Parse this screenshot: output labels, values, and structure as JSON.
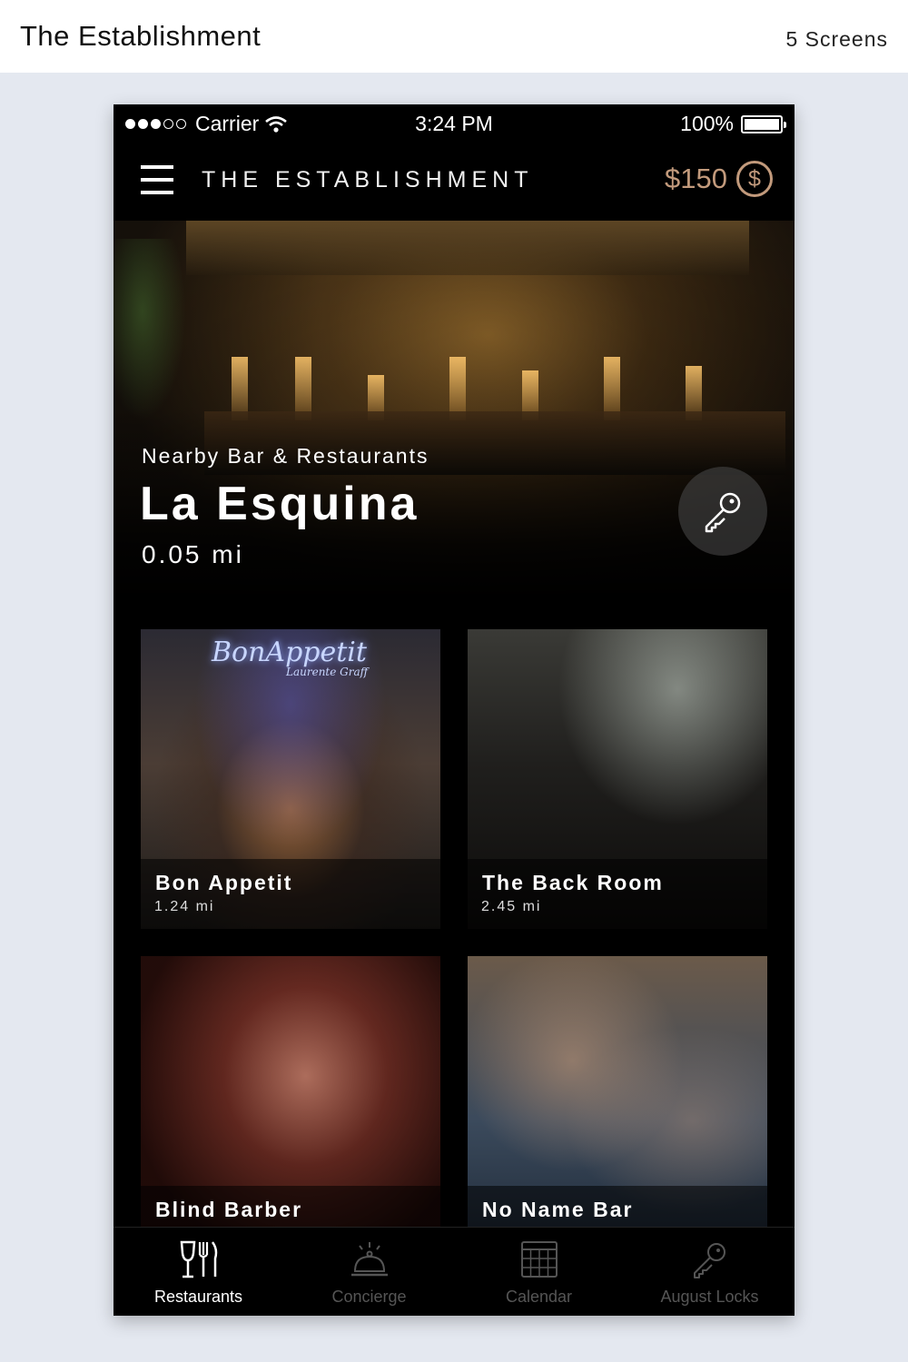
{
  "page": {
    "title": "The Establishment",
    "screens": "5 Screens"
  },
  "status": {
    "carrier": "Carrier",
    "time": "3:24 PM",
    "battery": "100%"
  },
  "nav": {
    "brand": "THE ESTABLISHMENT",
    "balance": "$150",
    "coin_symbol": "$"
  },
  "featured": {
    "subtitle": "Nearby Bar & Restaurants",
    "name": "La Esquina",
    "distance": "0.05 mi"
  },
  "places": [
    {
      "name": "Bon Appetit",
      "distance": "1.24 mi",
      "sign": "BonAppetit",
      "sign_sub": "Laurente Graff"
    },
    {
      "name": "The Back Room",
      "distance": "2.45 mi"
    },
    {
      "name": "Blind Barber",
      "distance": ""
    },
    {
      "name": "No Name Bar",
      "distance": ""
    }
  ],
  "tabs": [
    {
      "label": "Restaurants",
      "icon": "restaurant-icon",
      "active": true
    },
    {
      "label": "Concierge",
      "icon": "concierge-bell-icon",
      "active": false
    },
    {
      "label": "Calendar",
      "icon": "calendar-icon",
      "active": false
    },
    {
      "label": "August Locks",
      "icon": "key-icon",
      "active": false
    }
  ],
  "colors": {
    "accent": "#c29a7c",
    "tab_active": "#ffffff",
    "tab_inactive": "#555555"
  }
}
